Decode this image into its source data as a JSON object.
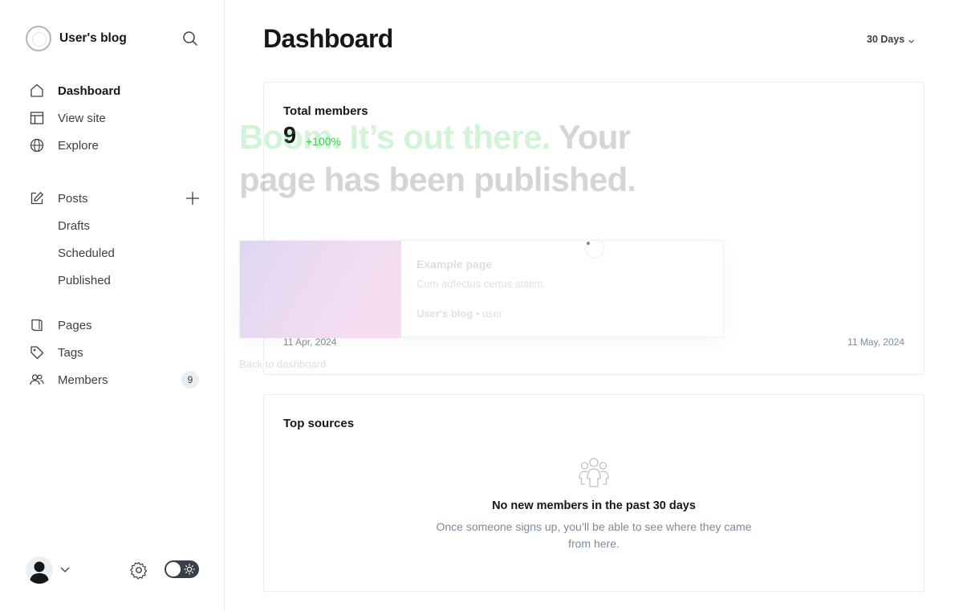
{
  "brand": {
    "name": "User's blog"
  },
  "nav": {
    "primary": [
      {
        "label": "Dashboard",
        "icon": "home-icon"
      },
      {
        "label": "View site",
        "icon": "layout-icon"
      },
      {
        "label": "Explore",
        "icon": "globe-icon"
      }
    ],
    "posts": {
      "label": "Posts",
      "icon": "edit-icon",
      "add_icon": "plus-icon"
    },
    "post_filters": [
      "Drafts",
      "Scheduled",
      "Published"
    ],
    "secondary": [
      {
        "label": "Pages",
        "icon": "page-icon"
      },
      {
        "label": "Tags",
        "icon": "tag-icon"
      },
      {
        "label": "Members",
        "icon": "members-icon",
        "badge": "9"
      }
    ]
  },
  "footer": {
    "avatar_icon": "user-avatar-icon",
    "settings_icon": "gear-icon",
    "theme_icon": "sun-icon"
  },
  "header": {
    "title": "Dashboard",
    "range": "30 Days"
  },
  "members_card": {
    "label": "Total members",
    "value": "9",
    "delta": "+100%",
    "date_start": "11 Apr, 2024",
    "date_end": "11 May, 2024"
  },
  "sources_card": {
    "label": "Top sources",
    "empty_title": "No new members in the past 30 days",
    "empty_desc": "Once someone signs up, you’ll be able to see where they came from here."
  },
  "publish_overlay": {
    "headline_accent": "Boom. It’s out there.",
    "headline_rest": " Your page has been published.",
    "bookmark_title": "Example page",
    "bookmark_desc": "Cum adfectus certus statim.",
    "bookmark_site": "User's blog",
    "bookmark_author": "user",
    "back_link": "Back to dashboard"
  },
  "colors": {
    "accent": "#30cf43",
    "text": "#15171a",
    "muted": "#7c8b9a",
    "border": "#ebeef0"
  }
}
